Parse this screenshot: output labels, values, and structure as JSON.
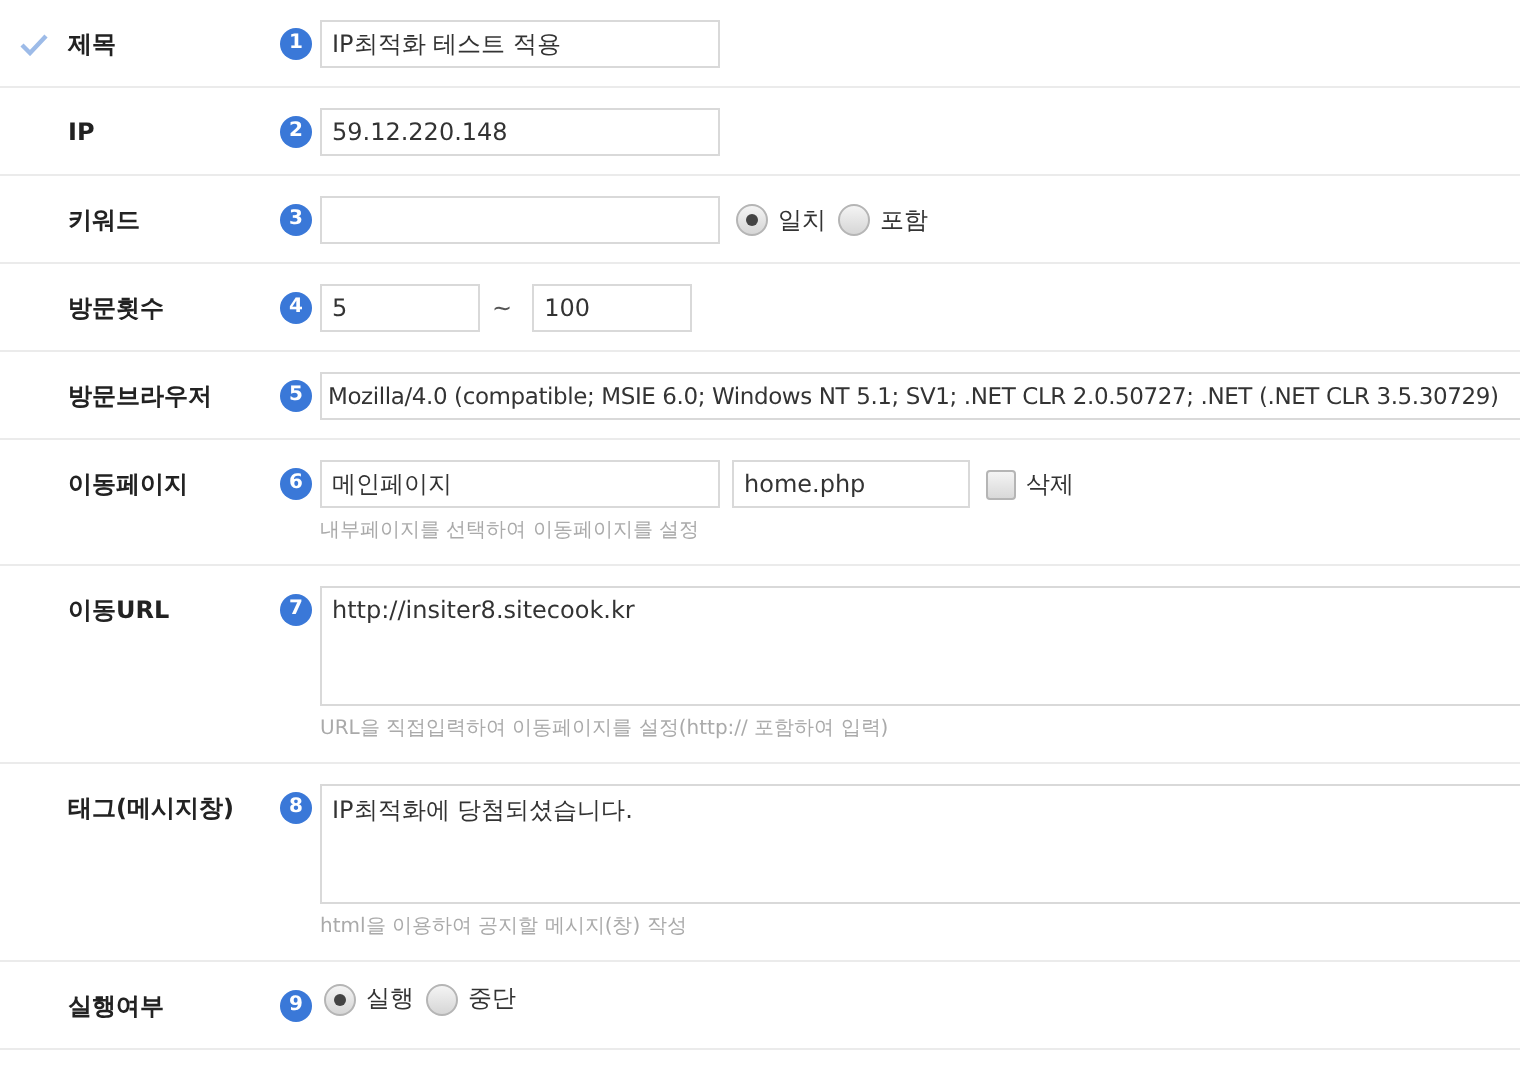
{
  "rows": [
    {
      "kind": "text",
      "label": "제목",
      "required": true,
      "number": "1",
      "value": "IP최적화 테스트 적용"
    },
    {
      "kind": "text",
      "label": "IP",
      "required": false,
      "number": "2",
      "value": "59.12.220.148"
    },
    {
      "kind": "text-radio",
      "label": "키워드",
      "required": false,
      "number": "3",
      "options": [
        {
          "label": "일치",
          "selected": true
        },
        {
          "label": "포함",
          "selected": false
        }
      ]
    },
    {
      "kind": "range",
      "label": "방문횟수",
      "required": false,
      "number": "4",
      "from": "5",
      "separator": "~",
      "to": "100"
    },
    {
      "kind": "wide",
      "label": "방문브라우저",
      "required": false,
      "number": "5",
      "value": "Mozilla/4.0 (compatible; MSIE 6.0; Windows NT 5.1; SV1; .NET CLR 2.0.50727; .NET (.NET CLR 3.5.30729)"
    },
    {
      "kind": "page",
      "label": "이동페이지",
      "required": false,
      "number": "6",
      "page_name": "메인페이지",
      "page_file": "home.php",
      "checkbox": {
        "label": "삭제",
        "checked": false
      },
      "hint": "내부페이지를 선택하여 이동페이지를 설정"
    },
    {
      "kind": "textarea",
      "label": "이동URL",
      "required": false,
      "number": "7",
      "value": "http://insiter8.sitecook.kr",
      "hint": "URL을 직접입력하여 이동페이지를 설정(http:// 포함하여 입력)"
    },
    {
      "kind": "textarea",
      "label": "태그(메시지창)",
      "required": false,
      "number": "8",
      "value": "IP최적화에 당첨되셨습니다.",
      "hint": "html을 이용하여 공지할 메시지(창) 작성"
    },
    {
      "kind": "radio",
      "label": "실행여부",
      "required": false,
      "number": "9",
      "options": [
        {
          "label": "실행",
          "selected": true
        },
        {
          "label": "중단",
          "selected": false
        }
      ]
    }
  ]
}
